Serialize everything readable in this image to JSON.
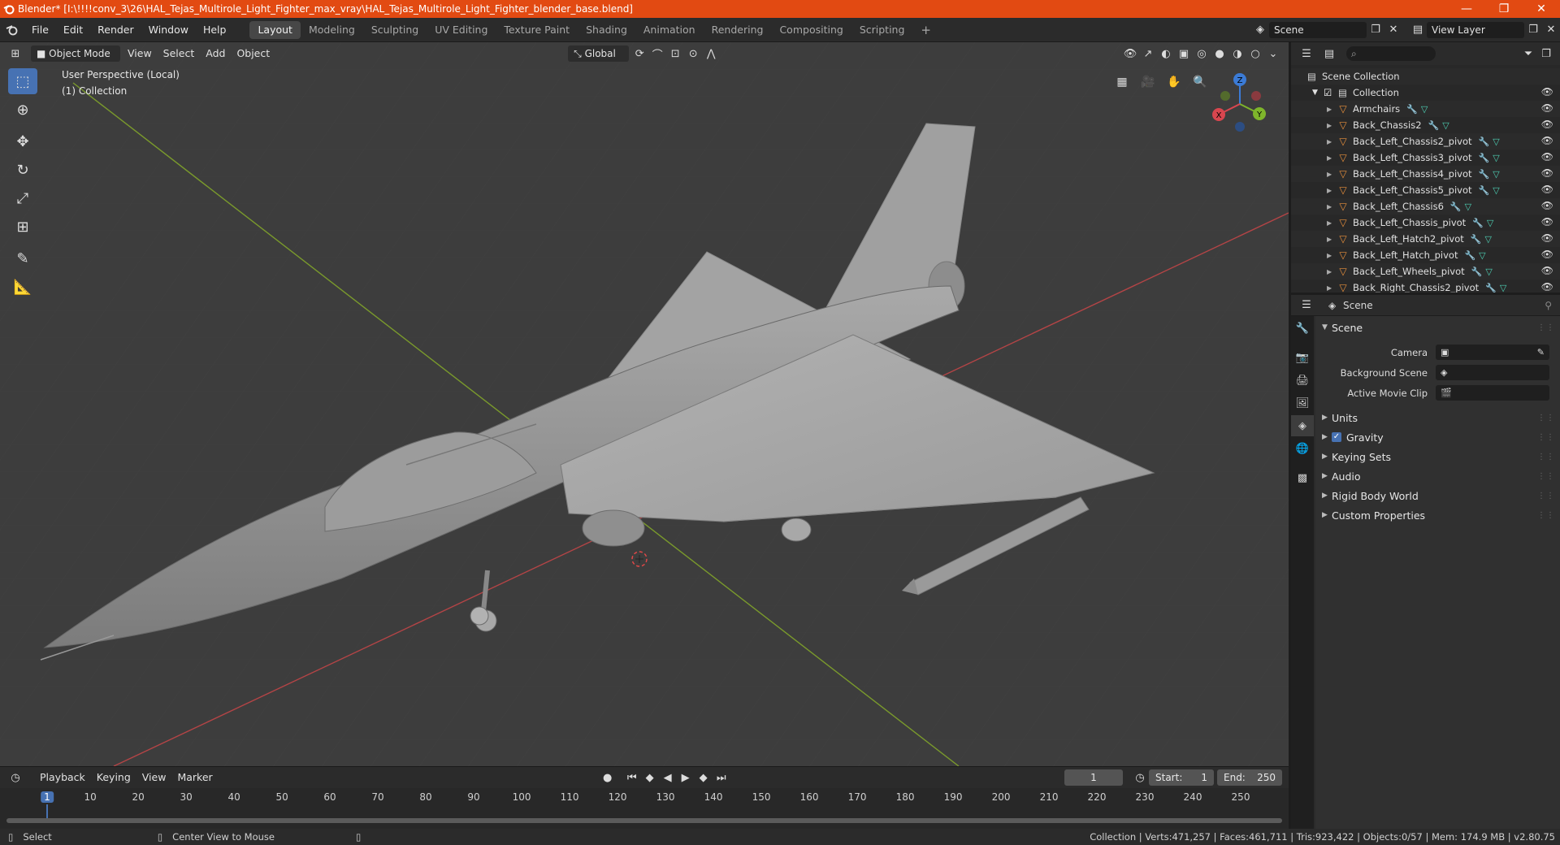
{
  "window": {
    "title": "Blender* [I:\\!!!!conv_3\\26\\HAL_Tejas_Multirole_Light_Fighter_max_vray\\HAL_Tejas_Multirole_Light_Fighter_blender_base.blend]",
    "controls": [
      "—",
      "❐",
      "✕"
    ]
  },
  "menubar": {
    "items": [
      "File",
      "Edit",
      "Render",
      "Window",
      "Help"
    ],
    "workspaces": [
      "Layout",
      "Modeling",
      "Sculpting",
      "UV Editing",
      "Texture Paint",
      "Shading",
      "Animation",
      "Rendering",
      "Compositing",
      "Scripting"
    ],
    "active_workspace": "Layout",
    "add_tab": "+",
    "scene": "Scene",
    "view_layer": "View Layer"
  },
  "viewport": {
    "mode": "Object Mode",
    "menus": [
      "View",
      "Select",
      "Add",
      "Object"
    ],
    "orientation": "Global",
    "perspective_label": "User Perspective (Local)",
    "collection_label": "(1) Collection",
    "gizmo": {
      "x": "X",
      "y": "Y",
      "z": "Z"
    }
  },
  "timeline": {
    "menus": [
      "Playback",
      "Keying",
      "View",
      "Marker"
    ],
    "current_frame": "1",
    "start_label": "Start:",
    "start": "1",
    "end_label": "End:",
    "end": "250",
    "ticks": [
      "1",
      "10",
      "20",
      "30",
      "40",
      "50",
      "60",
      "70",
      "80",
      "90",
      "100",
      "110",
      "120",
      "130",
      "140",
      "150",
      "160",
      "170",
      "180",
      "190",
      "200",
      "210",
      "220",
      "230",
      "240",
      "250"
    ]
  },
  "statusbar": {
    "left_action": "Select",
    "mid_action": "Center View to Mouse",
    "stats": "Collection | Verts:471,257 | Faces:461,711 | Tris:923,422 | Objects:0/57 | Mem: 174.9 MB | v2.80.75"
  },
  "outliner": {
    "scene_collection": "Scene Collection",
    "collection": "Collection",
    "items": [
      "Armchairs",
      "Back_Chassis2",
      "Back_Left_Chassis2_pivot",
      "Back_Left_Chassis3_pivot",
      "Back_Left_Chassis4_pivot",
      "Back_Left_Chassis5_pivot",
      "Back_Left_Chassis6",
      "Back_Left_Chassis_pivot",
      "Back_Left_Hatch2_pivot",
      "Back_Left_Hatch_pivot",
      "Back_Left_Wheels_pivot",
      "Back_Right_Chassis2_pivot"
    ]
  },
  "properties": {
    "context": "Scene",
    "panel_title": "Scene",
    "camera_label": "Camera",
    "background_scene_label": "Background Scene",
    "active_movie_clip_label": "Active Movie Clip",
    "subpanels": [
      "Units",
      "Gravity",
      "Keying Sets",
      "Audio",
      "Rigid Body World",
      "Custom Properties"
    ],
    "gravity_checked": true
  },
  "colors": {
    "titlebar": "#e24a12",
    "accent": "#4772b3",
    "viewport_bg": "#3d3d3d",
    "axis_x": "#c4494e",
    "axis_y": "#7ea22e"
  }
}
